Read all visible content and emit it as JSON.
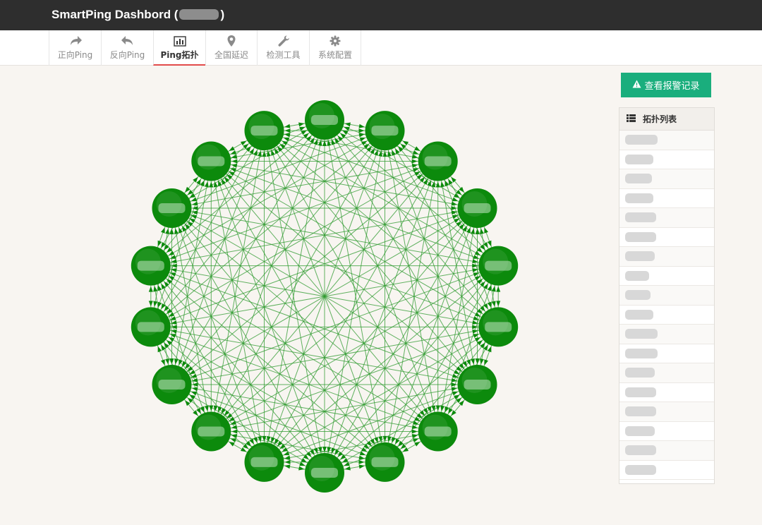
{
  "app": {
    "title": "SmartPing Dashbord (",
    "title_suffix": ")"
  },
  "nav": {
    "tabs": [
      {
        "label": "正向Ping",
        "icon": "forward-arrow-icon",
        "active": false
      },
      {
        "label": "反向Ping",
        "icon": "reply-arrow-icon",
        "active": false
      },
      {
        "label": "Ping拓扑",
        "icon": "bar-chart-icon",
        "active": true
      },
      {
        "label": "全国延迟",
        "icon": "map-marker-icon",
        "active": false
      },
      {
        "label": "检测工具",
        "icon": "wrench-icon",
        "active": false
      },
      {
        "label": "系统配置",
        "icon": "gear-icon",
        "active": false
      }
    ]
  },
  "alarm_button": {
    "label": "查看报警记录",
    "icon": "warning-icon",
    "color": "#1aae7d"
  },
  "topology_panel": {
    "title": "拓扑列表",
    "icon": "list-icon",
    "rows": [
      {
        "w": 46
      },
      {
        "w": 40
      },
      {
        "w": 38
      },
      {
        "w": 40
      },
      {
        "w": 44
      },
      {
        "w": 44
      },
      {
        "w": 42
      },
      {
        "w": 34
      },
      {
        "w": 36
      },
      {
        "w": 40
      },
      {
        "w": 46
      },
      {
        "w": 46
      },
      {
        "w": 42
      },
      {
        "w": 44
      },
      {
        "w": 44
      },
      {
        "w": 42
      },
      {
        "w": 44
      },
      {
        "w": 44
      }
    ]
  },
  "topology": {
    "node_count": 18,
    "node_color": "#0c8a0c",
    "edge_color": "#2e9a2e"
  }
}
